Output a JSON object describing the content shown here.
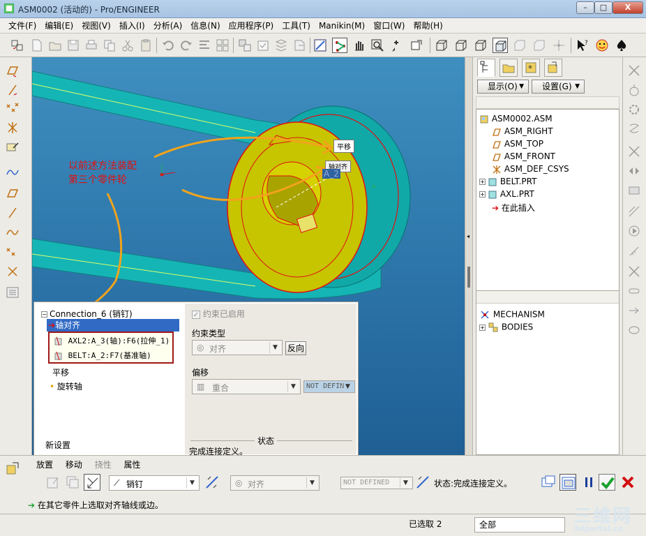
{
  "window": {
    "title": "ASM0002 (活动的) - Pro/ENGINEER",
    "controls": [
      "–",
      "□",
      "X"
    ]
  },
  "menu": [
    "文件(F)",
    "编辑(E)",
    "视图(V)",
    "插入(I)",
    "分析(A)",
    "信息(N)",
    "应用程序(P)",
    "工具(T)",
    "Manikin(M)",
    "窗口(W)",
    "帮助(H)"
  ],
  "viewport": {
    "annotation_line1": "以前述方法装配",
    "annotation_line2": "第三个零件轮",
    "label_pingyi": "平移",
    "label_zhouduiqi": "轴对齐",
    "label_a2": "A_2",
    "colors": {
      "background": "#2f79ad",
      "belt": "#18b7b7",
      "pulley_face": "#c7c400",
      "highlight": "#e01010",
      "arrow": "#f2a31c"
    }
  },
  "panel": {
    "connection": "Connection_6 (销钉)",
    "items": {
      "axis_align": "轴对齐",
      "ref1": "AXL2:A_3(轴):F6(拉伸_1)",
      "ref2": "BELT:A_2:F7(基准轴)",
      "translate": "平移",
      "rotate_axis": "旋转轴",
      "new_set": "新设置"
    },
    "constraint_enabled": "约束已启用",
    "constraint_type_label": "约束类型",
    "constraint_type_value": "对齐",
    "flip_button": "反向",
    "offset_label": "偏移",
    "offset_value": "重合",
    "offset_field": "NOT DEFIN",
    "status_label": "状态",
    "status_text": "完成连接定义。"
  },
  "model_tree": {
    "display_btn": "显示(O)",
    "settings_btn": "设置(G)",
    "nodes": {
      "root": "ASM0002.ASM",
      "right": "ASM_RIGHT",
      "top": "ASM_TOP",
      "front": "ASM_FRONT",
      "csys": "ASM_DEF_CSYS",
      "belt": "BELT.PRT",
      "axl": "AXL.PRT",
      "insert": "在此插入"
    },
    "mechanism": "MECHANISM",
    "bodies": "BODIES"
  },
  "dashboard": {
    "tabs": {
      "place": "放置",
      "move": "移动",
      "flex": "挠性",
      "props": "属性"
    },
    "connection_type": "销钉",
    "align_value": "对齐",
    "offset_value": "NOT DEFINED",
    "status": "状态:完成连接定义。"
  },
  "statusbar": {
    "message": "在其它零件上选取对齐轴线或边。",
    "selected": "已选取 2",
    "filter": "全部",
    "watermark_top": "三维网",
    "watermark_url": "3dportal.cn"
  }
}
